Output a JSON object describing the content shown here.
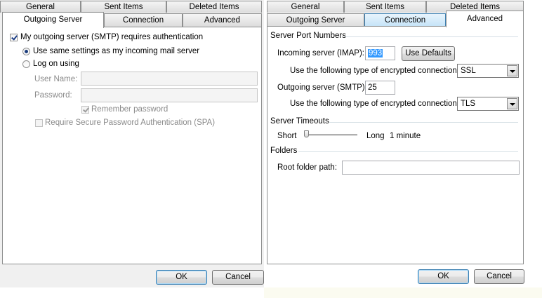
{
  "left": {
    "tabs_row1": [
      "General",
      "Sent Items",
      "Deleted Items"
    ],
    "tabs_row2": [
      "Outgoing Server",
      "Connection",
      "Advanced"
    ],
    "smtp_auth_label": "My outgoing server (SMTP) requires authentication",
    "smtp_auth_checked": true,
    "same_settings_label": "Use same settings as my incoming mail server",
    "logon_label": "Log on using",
    "user_name_label": "User Name:",
    "user_name_value": "",
    "password_label": "Password:",
    "password_value": "",
    "remember_label": "Remember password",
    "spa_label": "Require Secure Password Authentication (SPA)",
    "ok_label": "OK",
    "cancel_label": "Cancel"
  },
  "right": {
    "tabs_row1": [
      "General",
      "Sent Items",
      "Deleted Items"
    ],
    "tabs_row2": [
      "Outgoing Server",
      "Connection",
      "Advanced"
    ],
    "ports_group": "Server Port Numbers",
    "incoming_label": "Incoming server (IMAP):",
    "incoming_port": "993",
    "use_defaults_label": "Use Defaults",
    "encryption_label": "Use the following type of encrypted connection:",
    "incoming_encryption": "SSL",
    "outgoing_label": "Outgoing server (SMTP):",
    "outgoing_port": "25",
    "outgoing_encryption": "TLS",
    "timeouts_group": "Server Timeouts",
    "short_label": "Short",
    "long_label": "Long",
    "timeout_value": "1 minute",
    "timeout_fraction": 0.0,
    "folders_group": "Folders",
    "root_folder_label": "Root folder path:",
    "root_folder_value": "",
    "ok_label": "OK",
    "cancel_label": "Cancel"
  },
  "colors": {
    "selection": "#3399ff",
    "tab_highlight": "#c4e3f8",
    "group_line": "#d5dfe5"
  }
}
